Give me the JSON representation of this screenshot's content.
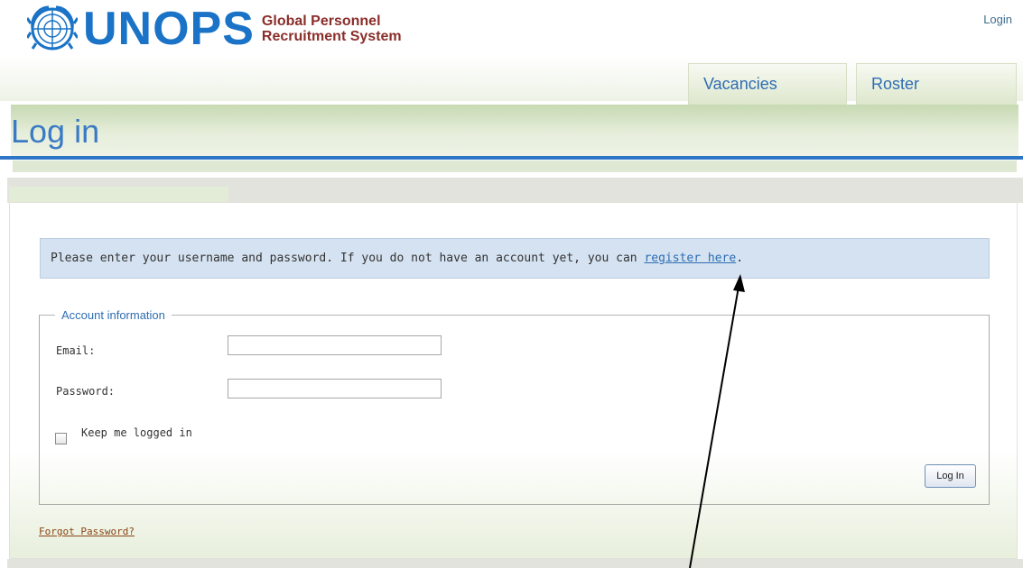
{
  "header": {
    "logo_text": "UNOPS",
    "tagline_line1": "Global Personnel",
    "tagline_line2": "Recruitment System",
    "login_link": "Login"
  },
  "nav": {
    "tabs": [
      {
        "label": "Vacancies"
      },
      {
        "label": "Roster"
      }
    ]
  },
  "page": {
    "title": "Log in"
  },
  "notice": {
    "text_before": "Please enter your username and password. If you do not have an account yet, you can ",
    "link": "register here",
    "text_after": "."
  },
  "form": {
    "legend": "Account information",
    "email_label": "Email:",
    "email_value": "",
    "password_label": "Password:",
    "password_value": "",
    "keep_logged_in_label": "Keep me logged in",
    "keep_logged_in_checked": false,
    "submit_label": "Log In"
  },
  "footer": {
    "forgot_password": "Forgot Password?"
  },
  "colors": {
    "brand_blue": "#1a73c6",
    "title_blue": "#3a7ac4",
    "rule_blue": "#2e75c8",
    "tagline_red": "#8a2e2a",
    "notice_bg": "#d4e2f1",
    "link_brown": "#8b4513"
  },
  "annotation": {
    "arrow_icon": "annotation-arrow pointing to register here link"
  }
}
